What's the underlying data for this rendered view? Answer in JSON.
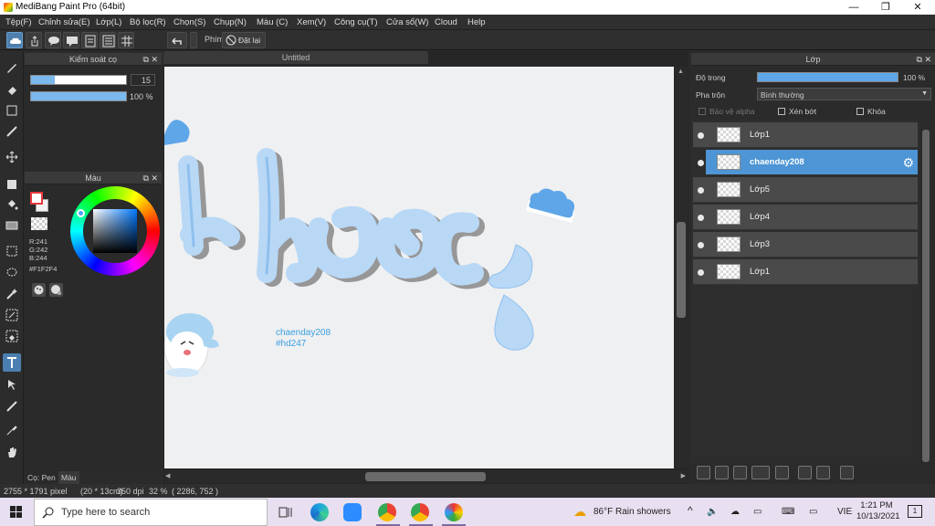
{
  "window": {
    "title": "MediBang Paint Pro (64bit)",
    "minimize": "—",
    "maximize": "❐",
    "close": "✕"
  },
  "menu": [
    "Tệp(F)",
    "Chỉnh sửa(E)",
    "Lớp(L)",
    "Bộ lọc(R)",
    "Chọn(S)",
    "Chụp(N)",
    "Màu (C)",
    "Xem(V)",
    "Công cụ(T)",
    "Cửa sổ(W)",
    "Cloud",
    "Help"
  ],
  "toolbar": {
    "brush_label": "Phím",
    "reset_label": "Đặt lại"
  },
  "brush_panel": {
    "title": "Kiểm soát cọ",
    "size_value": "15",
    "opacity_value": "100 %",
    "size_fill": 0.25,
    "opacity_fill": 1.0
  },
  "color_panel": {
    "title": "Màu",
    "r": "R:241",
    "g": "G:242",
    "b": "B:244",
    "hex": "#F1F2F4",
    "fg_color": "#e8383d",
    "bg_color": "#f1f2f4"
  },
  "tool_tabs": {
    "pen": "Cọ: Pen",
    "color": "Màu"
  },
  "canvas": {
    "tab_title": "Untitled",
    "lettering": "khoc",
    "credit_line1": "chaenday208",
    "credit_line2": "#hd247"
  },
  "layer_panel": {
    "title": "Lớp",
    "opacity_label": "Độ trong",
    "opacity_value": "100 %",
    "opacity_fill": 1.0,
    "blend_label": "Pha trộn",
    "blend_value": "Bình thường",
    "protect_alpha": "Bảo vệ alpha",
    "clipping": "Xén bớt",
    "lock": "Khóa",
    "layers": [
      {
        "name": "Lớp1",
        "selected": false
      },
      {
        "name": "chaenday208",
        "selected": true
      },
      {
        "name": "Lớp5",
        "selected": false
      },
      {
        "name": "Lớp4",
        "selected": false
      },
      {
        "name": "Lớp3",
        "selected": false
      },
      {
        "name": "Lớp1",
        "selected": false
      }
    ]
  },
  "status": {
    "pixels": "2755 * 1791 pixel",
    "cm": "(20 * 13cm)",
    "dpi": "350 dpi",
    "zoom": "32 %",
    "coords": "( 2286, 752 )"
  },
  "taskbar": {
    "search_placeholder": "Type here to search",
    "weather": "86°F  Rain showers",
    "lang": "VIE",
    "time": "1:21 PM",
    "date": "10/13/2021",
    "notif": "1"
  }
}
